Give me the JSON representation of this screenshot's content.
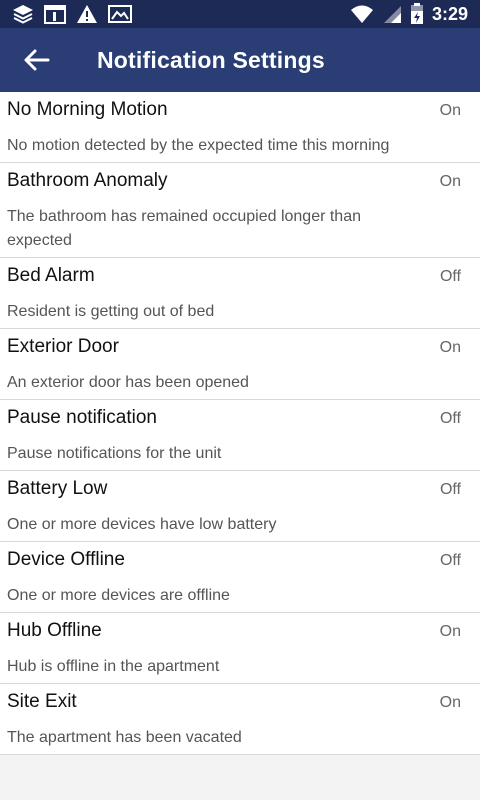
{
  "status_bar": {
    "time": "3:29",
    "icons": [
      "layers-icon",
      "calendar-icon",
      "warning-icon",
      "mail-icon",
      "wifi-icon",
      "signal-icon",
      "battery-icon"
    ]
  },
  "app_bar": {
    "title": "Notification Settings",
    "back_icon": "back-arrow-icon"
  },
  "settings": [
    {
      "title": "No Morning Motion",
      "state": "On",
      "description": "No motion detected by the expected time this morning"
    },
    {
      "title": "Bathroom Anomaly",
      "state": "On",
      "description": "The bathroom has remained occupied longer than expected"
    },
    {
      "title": "Bed Alarm",
      "state": "Off",
      "description": "Resident is getting out of bed"
    },
    {
      "title": "Exterior Door",
      "state": "On",
      "description": "An exterior door has been opened"
    },
    {
      "title": "Pause notification",
      "state": "Off",
      "description": "Pause notifications for the unit"
    },
    {
      "title": "Battery Low",
      "state": "Off",
      "description": "One or more devices have low battery"
    },
    {
      "title": "Device Offline",
      "state": "Off",
      "description": "One or more devices are offline"
    },
    {
      "title": "Hub Offline",
      "state": "On",
      "description": "Hub is offline in the apartment"
    },
    {
      "title": "Site Exit",
      "state": "On",
      "description": "The apartment has been vacated"
    }
  ],
  "colors": {
    "status_bar": "#1e2a56",
    "app_bar": "#2a3d74",
    "row_background": "#ffffff",
    "page_background": "#f3f3f3"
  }
}
